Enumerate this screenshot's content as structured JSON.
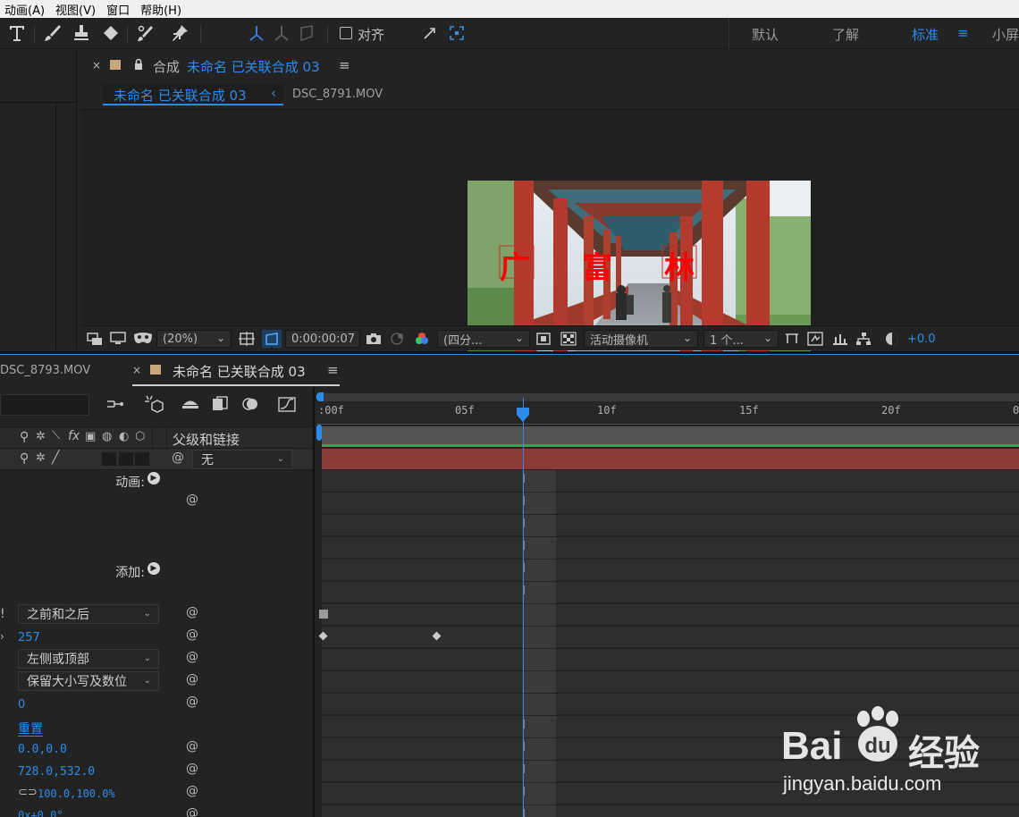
{
  "menu": [
    "动画(A)",
    "视图(V)",
    "窗口",
    "帮助(H)"
  ],
  "toolbar": {
    "align_label": "对齐",
    "workspaces": [
      "默认",
      "了解",
      "标准",
      "小屏"
    ],
    "active_workspace": "标准"
  },
  "comp_panel": {
    "close": "×",
    "tab_prefix": "合成",
    "tab_name": "未命名 已关联合成 03",
    "menu_glyph": "≡",
    "breadcrumb_active": "未命名 已关联合成 03",
    "breadcrumb_arrow": "‹",
    "breadcrumb_other": "DSC_8791.MOV",
    "overlay_text": [
      "广",
      "富",
      "林"
    ]
  },
  "viewer_bar": {
    "zoom": "(20%)",
    "timecode": "0:00:00:07",
    "resolution": "(四分...",
    "camera": "活动摄像机",
    "views": "1 个...",
    "exposure": "+0.0"
  },
  "timeline_tabs": {
    "other": "DSC_8793.MOV",
    "close": "×",
    "active": "未命名 已关联合成 03",
    "menu_glyph": "≡"
  },
  "layer_panel": {
    "header_col": "父级和链接",
    "parent_value": "无",
    "animate_label": "动画:",
    "add_label": "添加:",
    "rows": {
      "fill_order": "之前和之后",
      "leading": "257",
      "anchor_grouping": "左侧或顶部",
      "case": "保留大小写及数位",
      "zero": "0",
      "reset": "重置",
      "anchor": "0.0,0.0",
      "position": "728.0,532.0",
      "scale": "100.0,100.0%",
      "partial": "0x+0.0°"
    }
  },
  "ruler": {
    "ticks": [
      ":00f",
      "05f",
      "10f",
      "15f",
      "20f",
      "0"
    ]
  },
  "watermark": {
    "brand": "Bai",
    "brand_end": "du",
    "cn": "经验",
    "url": "jingyan.baidu.com"
  },
  "colors": {
    "accent_blue": "#2d8ceb",
    "layer_bar": "#8b3a3a",
    "work_area_green": "#2fa84f"
  }
}
